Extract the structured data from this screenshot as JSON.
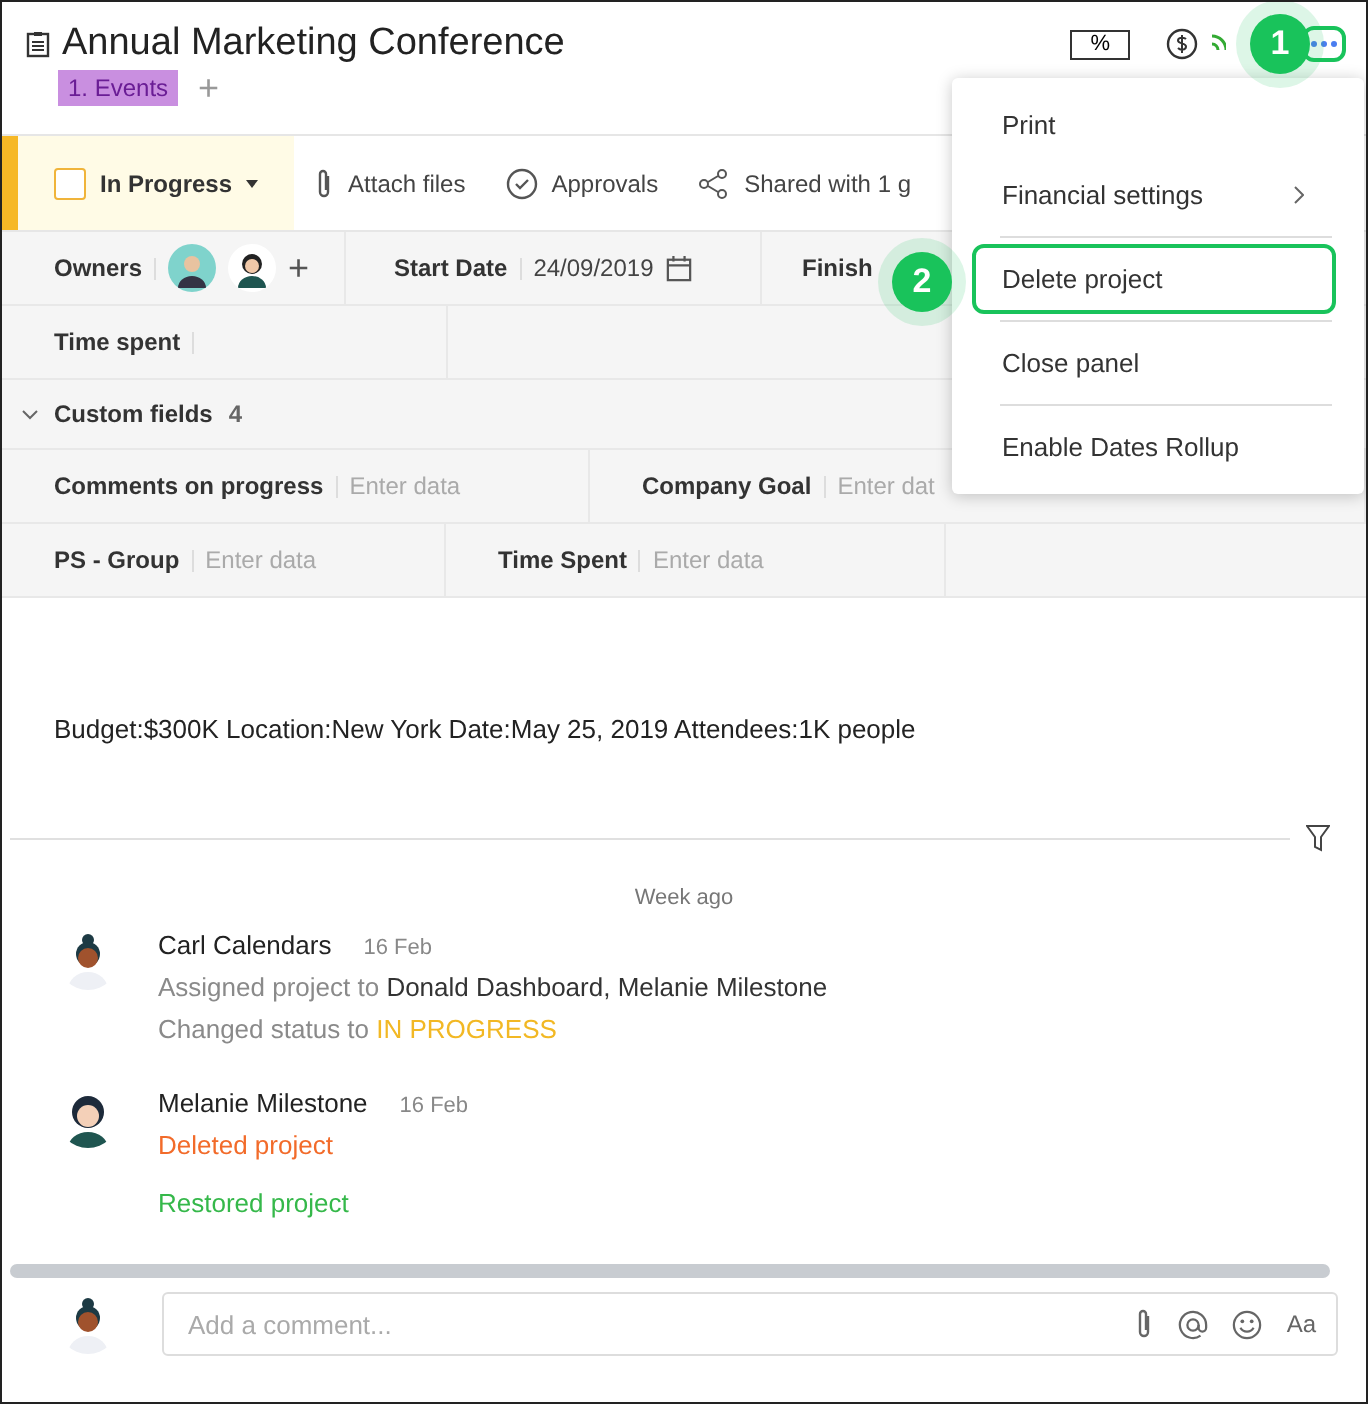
{
  "header": {
    "title": "Annual Marketing Conference",
    "tag": "1. Events",
    "add_tag": "+",
    "percent_button": "%"
  },
  "toolbar": {
    "status": "In Progress",
    "status_checked": false,
    "items": [
      {
        "kind": "attach",
        "label": "Attach files"
      },
      {
        "kind": "approve",
        "label": "Approvals"
      },
      {
        "kind": "share",
        "label": "Shared with 1 g"
      }
    ]
  },
  "fields": {
    "owners_label": "Owners",
    "add_owner": "+",
    "start_label": "Start Date",
    "start_value": "24/09/2019",
    "finish_label": "Finish",
    "time_label": "Time spent"
  },
  "custom_fields": {
    "title": "Custom fields",
    "count": "4",
    "expanded": true,
    "rows": [
      [
        {
          "label": "Comments on progress",
          "placeholder": "Enter data"
        },
        {
          "label": "Company Goal",
          "placeholder": "Enter dat"
        }
      ],
      [
        {
          "label": "PS - Group",
          "placeholder": "Enter data"
        },
        {
          "label": "Time Spent",
          "placeholder": "Enter data"
        }
      ]
    ]
  },
  "description": "Budget:$300K Location:New York Date:May 25, 2019 Attendees:1K people",
  "activity": {
    "period": "Week ago",
    "entries": [
      {
        "author": "Carl Calendars",
        "date": "16 Feb",
        "lines": [
          [
            {
              "text": "Assigned project to ",
              "color": "#8a8a8a"
            },
            {
              "text": "Donald Dashboard, Melanie Milestone",
              "color": "#333333"
            }
          ],
          [
            {
              "text": "Changed status to ",
              "color": "#8a8a8a"
            },
            {
              "text": "IN PROGRESS",
              "color": "#f2b824"
            }
          ]
        ]
      },
      {
        "author": "Melanie Milestone",
        "date": "16 Feb",
        "lines": [
          [
            {
              "text": "Deleted project",
              "color": "#f26b2a"
            }
          ],
          [
            {
              "text": "Restored project",
              "color": "#35b84a"
            }
          ]
        ]
      }
    ]
  },
  "comment": {
    "placeholder": "Add a comment...",
    "format_button": "Aa"
  },
  "menu": {
    "groups": [
      [
        {
          "label": "Print",
          "submenu": false,
          "selected": false
        },
        {
          "label": "Financial settings",
          "submenu": true,
          "selected": false
        }
      ],
      [
        {
          "label": "Delete project",
          "submenu": false,
          "selected": true
        }
      ],
      [
        {
          "label": "Close panel",
          "submenu": false,
          "selected": false
        }
      ],
      [
        {
          "label": "Enable Dates Rollup",
          "submenu": false,
          "selected": false
        }
      ]
    ]
  },
  "callouts": [
    {
      "label": "1"
    },
    {
      "label": "2"
    }
  ]
}
